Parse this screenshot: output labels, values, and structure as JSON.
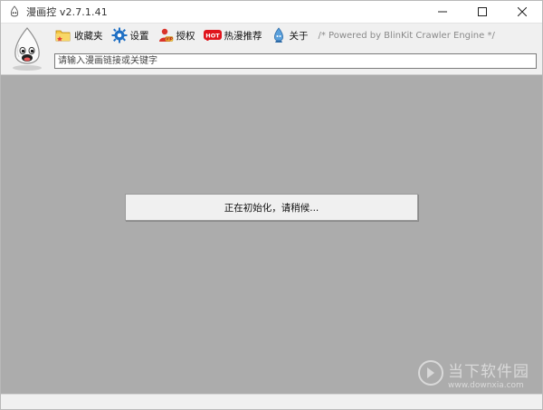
{
  "window": {
    "title": "漫画控 v2.7.1.41",
    "controls": {
      "minimize": "—",
      "maximize": "☐",
      "close": "✕"
    }
  },
  "toolbar": {
    "items": [
      {
        "label": "收藏夹",
        "icon": "folder-star-icon"
      },
      {
        "label": "设置",
        "icon": "gear-icon"
      },
      {
        "label": "授权",
        "icon": "vip-user-icon"
      },
      {
        "label": "热漫推荐",
        "icon": "hot-badge-icon",
        "badge": "HOT"
      },
      {
        "label": "关于",
        "icon": "about-drop-icon"
      }
    ],
    "powered_text": "/* Powered by BlinKit Crawler Engine */"
  },
  "search": {
    "value": "",
    "placeholder": "请输入漫画链接或关键字"
  },
  "main": {
    "status_message": "正在初始化，请稍候..."
  },
  "watermark": {
    "title": "当下软件园",
    "url": "www.downxia.com"
  },
  "colors": {
    "main_bg": "#acacac",
    "toolbar_bg": "#f0f0f0",
    "hot_red": "#e0141c",
    "gear_blue": "#1e6fc4"
  }
}
